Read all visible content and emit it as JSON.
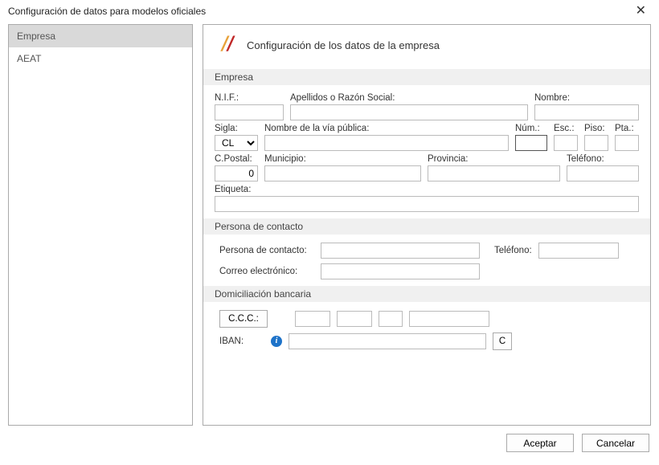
{
  "window": {
    "title": "Configuración de datos para modelos oficiales"
  },
  "sidebar": {
    "items": [
      {
        "label": "Empresa",
        "selected": true
      },
      {
        "label": "AEAT",
        "selected": false
      }
    ]
  },
  "panel": {
    "title": "Configuración de los datos de la empresa"
  },
  "sections": {
    "empresa": {
      "title": "Empresa"
    },
    "contacto": {
      "title": "Persona de contacto"
    },
    "domiciliacion": {
      "title": "Domiciliación bancaria"
    }
  },
  "empresa": {
    "nif": {
      "label": "N.I.F.:",
      "value": ""
    },
    "apellidos": {
      "label": "Apellidos o Razón Social:",
      "value": ""
    },
    "nombre": {
      "label": "Nombre:",
      "value": ""
    },
    "sigla": {
      "label": "Sigla:",
      "value": "CL",
      "options": [
        "CL"
      ]
    },
    "via": {
      "label": "Nombre de la vía pública:",
      "value": ""
    },
    "num": {
      "label": "Núm.:",
      "value": ""
    },
    "esc": {
      "label": "Esc.:",
      "value": ""
    },
    "piso": {
      "label": "Piso:",
      "value": ""
    },
    "pta": {
      "label": "Pta.:",
      "value": ""
    },
    "cpostal": {
      "label": "C.Postal:",
      "value": "0"
    },
    "municipio": {
      "label": "Municipio:",
      "value": ""
    },
    "provincia": {
      "label": "Provincia:",
      "value": ""
    },
    "telefono": {
      "label": "Teléfono:",
      "value": ""
    },
    "etiqueta": {
      "label": "Etiqueta:",
      "value": ""
    }
  },
  "contacto": {
    "persona": {
      "label": "Persona de contacto:",
      "value": ""
    },
    "telefono": {
      "label": "Teléfono:",
      "value": ""
    },
    "correo": {
      "label": "Correo electrónico:",
      "value": ""
    }
  },
  "domiciliacion": {
    "ccc": {
      "label": "C.C.C.:",
      "b1": "",
      "b2": "",
      "b3": "",
      "b4": ""
    },
    "iban": {
      "label": "IBAN:",
      "value": "",
      "calc": "C"
    }
  },
  "footer": {
    "accept": "Aceptar",
    "cancel": "Cancelar"
  }
}
